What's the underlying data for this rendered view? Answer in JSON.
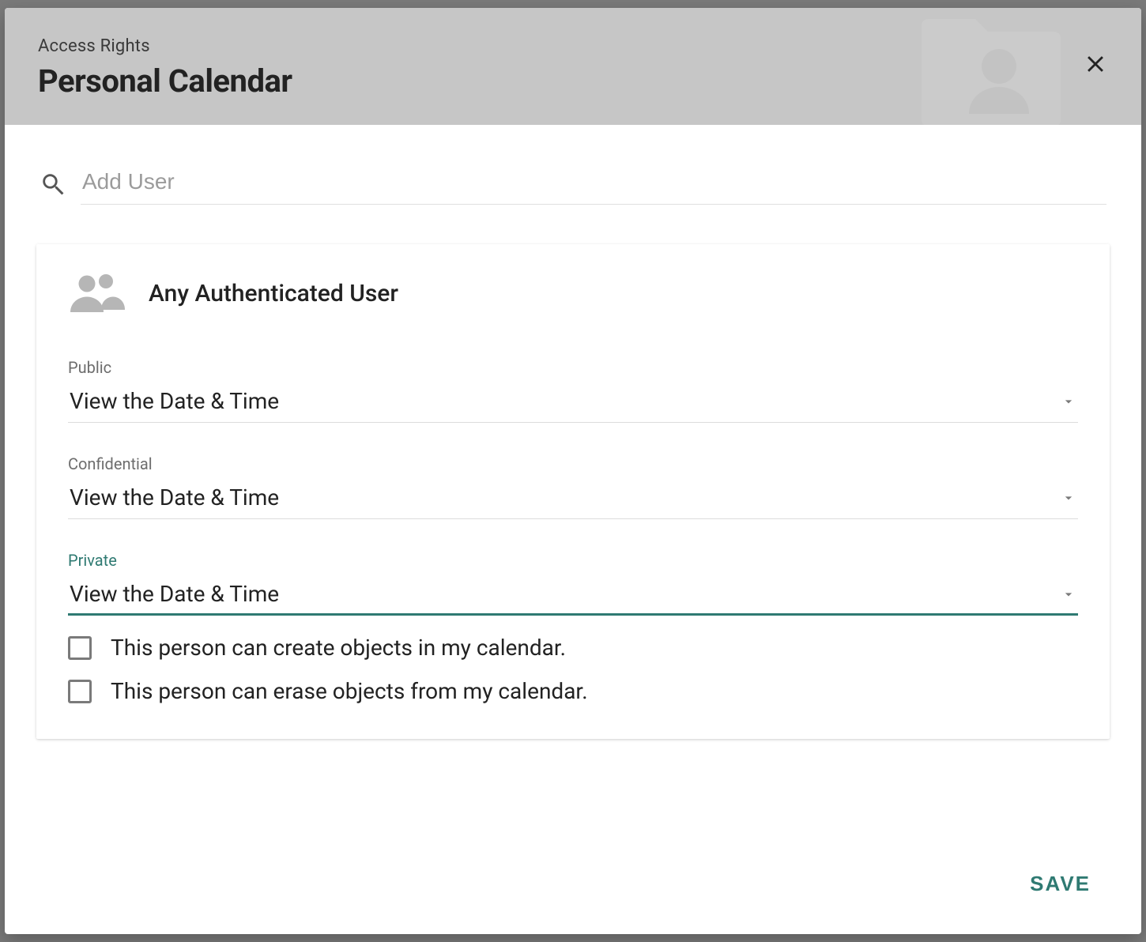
{
  "header": {
    "subtitle": "Access Rights",
    "title": "Personal Calendar"
  },
  "search": {
    "placeholder": "Add User",
    "value": ""
  },
  "card": {
    "title": "Any Authenticated User",
    "permissions": {
      "public": {
        "label": "Public",
        "value": "View the Date & Time",
        "active": false
      },
      "confidential": {
        "label": "Confidential",
        "value": "View the Date & Time",
        "active": false
      },
      "private": {
        "label": "Private",
        "value": "View the Date & Time",
        "active": true
      }
    },
    "checkboxes": {
      "create": {
        "label": "This person can create objects in my calendar.",
        "checked": false
      },
      "erase": {
        "label": "This person can erase objects from my calendar.",
        "checked": false
      }
    }
  },
  "footer": {
    "save_label": "SAVE"
  },
  "colors": {
    "accent": "#2f7a72"
  }
}
